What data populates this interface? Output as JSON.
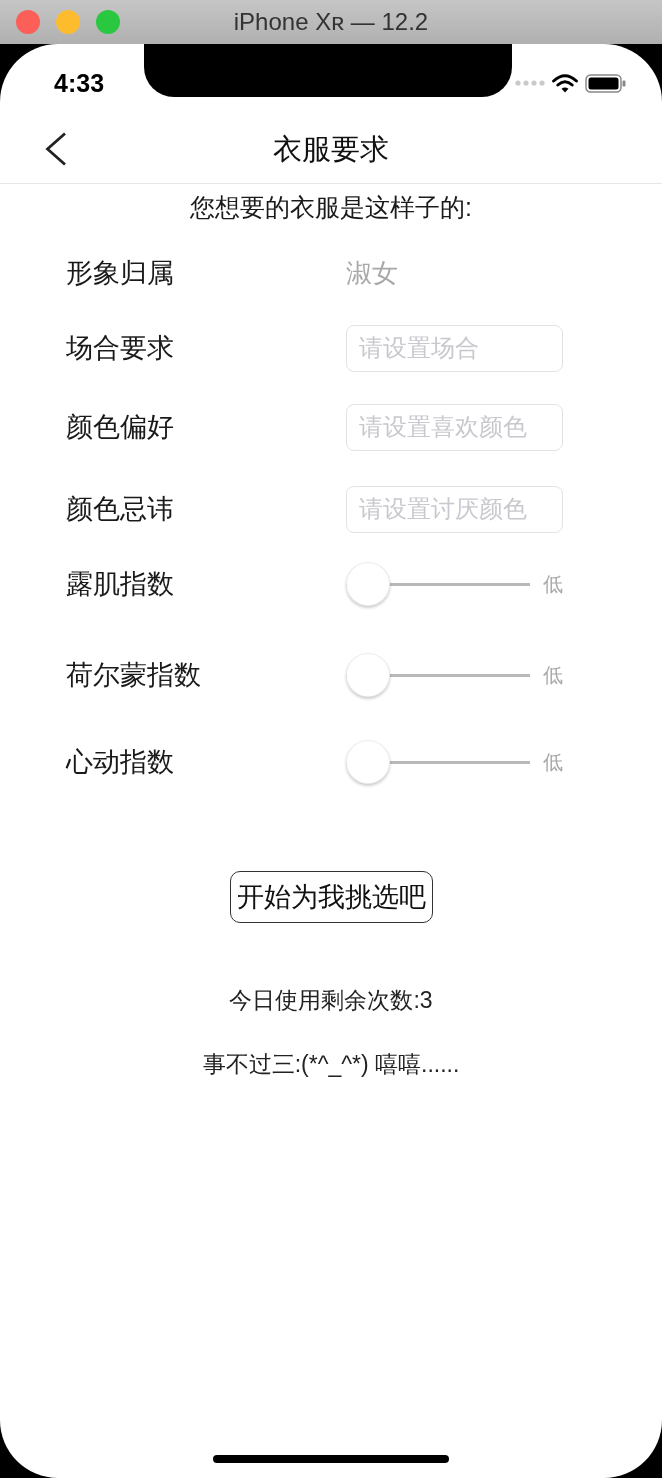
{
  "window": {
    "title": "iPhone Xʀ — 12.2"
  },
  "status_bar": {
    "time": "4:33"
  },
  "nav_bar": {
    "title": "衣服要求"
  },
  "form": {
    "heading": "您想要的衣服是这样子的:",
    "rows": [
      {
        "kind": "value",
        "label": "形象归属",
        "value": "淑女"
      },
      {
        "kind": "input",
        "label": "场合要求",
        "placeholder": "请设置场合"
      },
      {
        "kind": "input",
        "label": "颜色偏好",
        "placeholder": "请设置喜欢颜色"
      },
      {
        "kind": "input",
        "label": "颜色忌讳",
        "placeholder": "请设置讨厌颜色"
      },
      {
        "kind": "slider",
        "label": "露肌指数",
        "level": 0,
        "reading": "低"
      },
      {
        "kind": "slider",
        "label": "荷尔蒙指数",
        "level": 0,
        "reading": "低"
      },
      {
        "kind": "slider",
        "label": "心动指数",
        "level": 0,
        "reading": "低"
      }
    ]
  },
  "submit_button": {
    "label": "开始为我挑选吧"
  },
  "remaining_uses": "今日使用剩余次数:3",
  "note": "事不过三:(*^_^*) 嘻嘻......"
}
